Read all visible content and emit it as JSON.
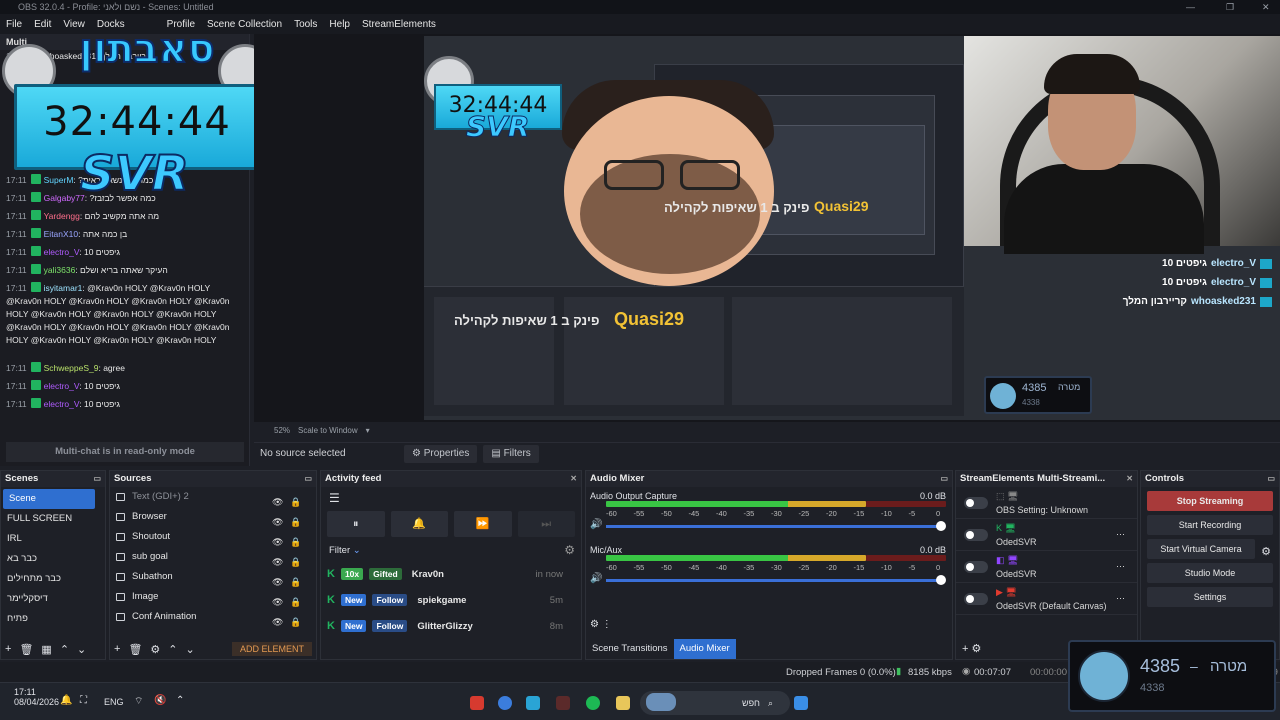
{
  "window": {
    "title": "OBS 32.0.4 - Profile: נשם ולאני - Scenes: Untitled"
  },
  "menu": [
    "File",
    "Edit",
    "View",
    "Docks",
    "Profile",
    "Scene Collection",
    "Tools",
    "Help",
    "StreamElements"
  ],
  "chat": {
    "title": "Multi",
    "footer": "Multi-chat is in read-only mode",
    "messages": [
      {
        "time": "17:11",
        "user": "SuperM",
        "text": "?כמה זמן נשאר ראית"
      },
      {
        "time": "17:11",
        "user": "Galgaby77",
        "text": "?כמה אפשר לבזבז"
      },
      {
        "time": "17:11",
        "user": "Yardengg",
        "text": "מה אתה מקשיב להם"
      },
      {
        "time": "17:11",
        "user": "EitanX10",
        "text": "בן כמה אתה"
      },
      {
        "time": "17:11",
        "user": "electro_V",
        "text": "גיפטים 10"
      },
      {
        "time": "17:11",
        "user": "yali3636",
        "text": "העיקר שאתה בריא ושלם"
      },
      {
        "time": "17:11",
        "user": "isyitamar1",
        "text": "@Krav0n HOLY @Krav0n HOLY @Krav0n HOLY @Krav0n HOLY @Krav0n HOLY @Krav0n HOLY @Krav0n HOLY @Krav0n HOLY @Krav0n HOLY @Krav0n HOLY @Krav0n HOLY @Krav0n HOLY @Krav0n HOLY @Krav0n HOLY @Krav0n HOLY @Krav0n HOLY"
      },
      {
        "time": "17:11",
        "user": "SchweppeS_9",
        "text": "agree"
      },
      {
        "time": "17:11",
        "user": "electro_V",
        "text": "גיפטים 10"
      },
      {
        "time": "17:11",
        "user": "electro_V",
        "text": "גיפטים 10"
      },
      {
        "time": "17:11",
        "user": "whoasked231",
        "text": "קריירבון המלך"
      }
    ]
  },
  "overlay": {
    "clock": "32:44:44",
    "brand": "סאבתון",
    "sub": "SVR"
  },
  "preview": {
    "zoom": "52%",
    "scale_label": "Scale to Window",
    "alert_name": "Quasi29",
    "alert_text": "פינק ב 1 שאיפות לקהילה",
    "chat_lines": [
      {
        "user": "electro_V",
        "text": "גיפטים 10"
      },
      {
        "user": "electro_V",
        "text": "גיפטים 10"
      },
      {
        "user": "whoasked231",
        "text": "קריירבון המלך"
      }
    ]
  },
  "strip": {
    "no_source": "No source selected",
    "properties": "Properties",
    "filters": "Filters"
  },
  "scenes": {
    "title": "Scenes",
    "items": [
      "Scene",
      "FULL SCREEN",
      "IRL",
      "כבר בא",
      "כבר מתחילים",
      "דיסקליימר",
      "פתיח"
    ]
  },
  "sources": {
    "title": "Sources",
    "items": [
      "Text (GDI+) 2",
      "Browser",
      "Shoutout",
      "sub goal",
      "Subathon",
      "Image",
      "Conf Animation"
    ],
    "add": "ADD ELEMENT"
  },
  "activity": {
    "title": "Activity feed",
    "filter": "Filter",
    "rows": [
      {
        "badge": "10x",
        "badge2": "Gifted",
        "name": "Krav0n",
        "time": "in now"
      },
      {
        "badge": "New",
        "badge2": "Follow",
        "name": "spiekgame",
        "time": "5m"
      },
      {
        "badge": "New",
        "badge2": "Follow",
        "name": "GlitterGlizzy",
        "time": "8m"
      }
    ]
  },
  "mixer": {
    "title": "Audio Mixer",
    "channels": [
      {
        "name": "Audio Output Capture",
        "db": "0.0 dB"
      },
      {
        "name": "Mic/Aux",
        "db": "0.0 dB"
      }
    ],
    "ticks": [
      "-60",
      "-55",
      "-50",
      "-45",
      "-40",
      "-35",
      "-30",
      "-25",
      "-20",
      "-15",
      "-10",
      "-5",
      "0"
    ],
    "tabs": [
      "Scene Transitions",
      "Audio Mixer"
    ]
  },
  "se": {
    "title": "StreamElements Multi-Streami...",
    "items": [
      {
        "label": "OBS Setting: Unknown"
      },
      {
        "label": "OdedSVR"
      },
      {
        "label": "OdedSVR"
      },
      {
        "label": "OdedSVR (Default Canvas)"
      }
    ]
  },
  "controls": {
    "title": "Controls",
    "buttons": [
      "Stop Streaming",
      "Start Recording",
      "Start Virtual Camera",
      "Studio Mode",
      "Settings"
    ]
  },
  "status": {
    "dropped": "Dropped Frames 0 (0.0%)",
    "kbps": "8185 kbps",
    "rec": "00:07:07",
    "stream": "00:00:00",
    "fps": "549"
  },
  "taskbar": {
    "time": "17:11",
    "date": "08/04/2026",
    "lang": "ENG",
    "search": "חפש"
  },
  "widget": {
    "value": "4385",
    "label": "מטרה",
    "sub": "4338"
  },
  "colors": {
    "accent": "#2f6fd0",
    "stop": "#a83a3a",
    "kick": "#21b35f",
    "follow": "#2f6fd0"
  }
}
